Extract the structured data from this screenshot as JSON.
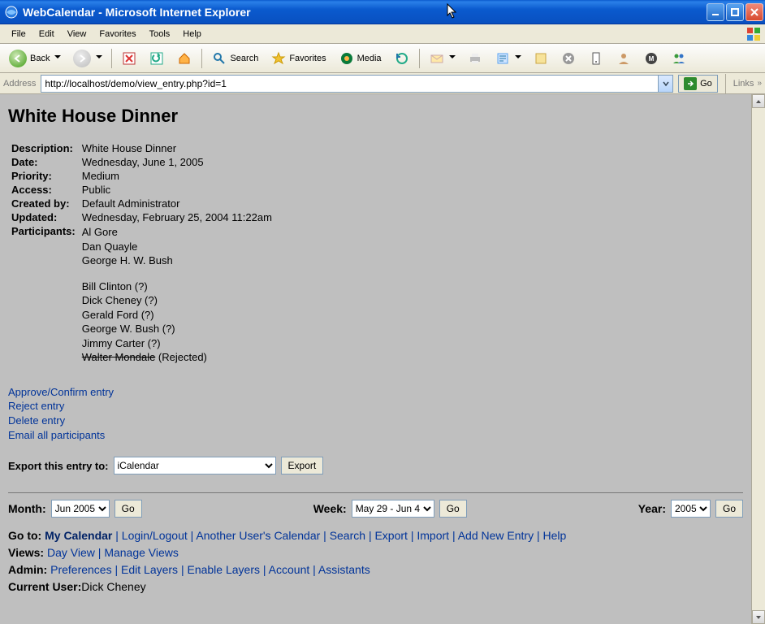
{
  "window": {
    "title": "WebCalendar - Microsoft Internet Explorer"
  },
  "menubar": [
    "File",
    "Edit",
    "View",
    "Favorites",
    "Tools",
    "Help"
  ],
  "toolbar": {
    "back": "Back",
    "search": "Search",
    "favorites": "Favorites",
    "media": "Media"
  },
  "addressbar": {
    "label": "Address",
    "url": "http://localhost/demo/view_entry.php?id=1",
    "go": "Go",
    "links": "Links"
  },
  "entry": {
    "title": "White House Dinner",
    "fields": {
      "description_label": "Description:",
      "description": "White House Dinner",
      "date_label": "Date:",
      "date": "Wednesday, June 1, 2005",
      "priority_label": "Priority:",
      "priority": "Medium",
      "access_label": "Access:",
      "access": "Public",
      "createdby_label": "Created by:",
      "createdby": "Default Administrator",
      "updated_label": "Updated:",
      "updated": "Wednesday, February 25, 2004 11:22am",
      "participants_label": "Participants:"
    },
    "participants_confirmed": [
      "Al Gore",
      "Dan Quayle",
      "George H. W. Bush"
    ],
    "participants_pending": [
      "Bill Clinton (?)",
      "Dick Cheney (?)",
      "Gerald Ford (?)",
      "George W. Bush (?)",
      "Jimmy Carter (?)"
    ],
    "participant_rejected_name": "Walter Mondale",
    "participant_rejected_suffix": " (Rejected)",
    "actions": {
      "approve": "Approve/Confirm entry",
      "reject": "Reject entry",
      "delete": "Delete entry",
      "email": "Email all participants"
    },
    "export": {
      "label": "Export this entry to:",
      "selected": "iCalendar",
      "button": "Export"
    }
  },
  "nav": {
    "month_label": "Month:",
    "month_value": "Jun 2005",
    "week_label": "Week:",
    "week_value": "May 29 - Jun 4",
    "year_label": "Year:",
    "year_value": "2005",
    "go": "Go"
  },
  "footer": {
    "goto_label": "Go to:",
    "my_calendar": "My Calendar",
    "login": "Login/Logout",
    "another": "Another User's Calendar",
    "search": "Search",
    "export": "Export",
    "import": "Import",
    "add": "Add New Entry",
    "help": "Help",
    "views_label": "Views:",
    "day_view": "Day View",
    "manage_views": "Manage Views",
    "admin_label": "Admin:",
    "preferences": "Preferences",
    "edit_layers": "Edit Layers",
    "enable_layers": "Enable Layers",
    "account": "Account",
    "assistants": "Assistants",
    "current_user_label": "Current User:",
    "current_user": "Dick Cheney"
  }
}
